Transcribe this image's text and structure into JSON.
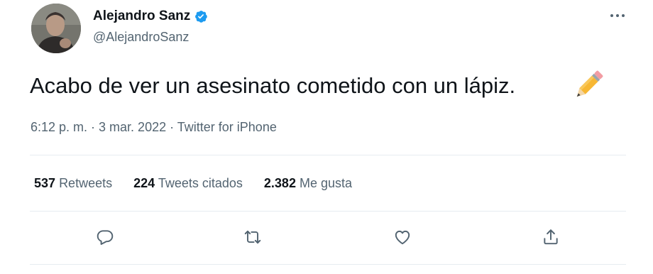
{
  "author": {
    "name": "Alejandro Sanz",
    "handle": "@AlejandroSanz",
    "verified": true
  },
  "tweet": {
    "text": "Acabo de ver un asesinato cometido con un lápiz.",
    "emoji": "pencil-emoji",
    "timestamp": "6:12 p. m. · 3 mar. 2022 · Twitter for iPhone"
  },
  "stats": [
    {
      "count": "537",
      "label": "Retweets"
    },
    {
      "count": "224",
      "label": "Tweets citados"
    },
    {
      "count": "2.382",
      "label": "Me gusta"
    }
  ],
  "actions": [
    "reply-icon",
    "retweet-icon",
    "like-icon",
    "share-icon"
  ],
  "colors": {
    "text": "#0f1419",
    "secondary": "#536471",
    "verified": "#1d9bf0",
    "divider": "#e6ecf0"
  }
}
